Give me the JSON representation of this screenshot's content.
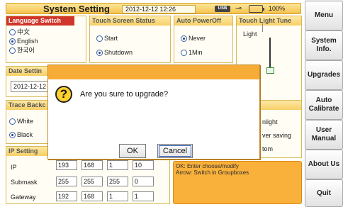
{
  "header": {
    "title": "System Setting",
    "datetime": "2012-12-12 12:26",
    "usb_label": "USB",
    "battery_label": "100%",
    "battery_level": 1.0
  },
  "language": {
    "title": "Language Switch",
    "options": [
      "中文",
      "English",
      "한국어"
    ],
    "selected": "English"
  },
  "touch_status": {
    "title": "Touch Screen Status",
    "options": [
      "Start",
      "Shutdown"
    ],
    "selected": "Shutdown"
  },
  "power_off": {
    "title": "Auto PowerOff",
    "options": [
      "Never",
      "1Min"
    ],
    "selected": "Never"
  },
  "touch_light": {
    "title": "Touch Light Tune",
    "light_label": "Light"
  },
  "date_setting": {
    "title": "Date Settin",
    "value": "2012-12-12"
  },
  "trace": {
    "title": "Trace Backc",
    "options": [
      "White",
      "Black"
    ],
    "selected": "Black"
  },
  "light_mode": {
    "title": "t",
    "options": [
      "nlight",
      "ver saving",
      "tom"
    ]
  },
  "ip_setting": {
    "title": "IP Setting",
    "rows": [
      {
        "label": "IP",
        "values": [
          "193",
          "168",
          "1",
          "10"
        ]
      },
      {
        "label": "Submask",
        "values": [
          "255",
          "255",
          "255",
          "0"
        ]
      },
      {
        "label": "Gateway",
        "values": [
          "192",
          "168",
          "1",
          "1"
        ]
      }
    ]
  },
  "info": {
    "line1": "OK: Enter choose/modify",
    "line2": "Arrow: Switch in Groupboxes"
  },
  "sidebar": [
    {
      "label": "Menu"
    },
    {
      "label": "System Info."
    },
    {
      "label": "Upgrades"
    },
    {
      "label": "Auto Calibrate"
    },
    {
      "label": "User Manual"
    },
    {
      "label": "About Us"
    },
    {
      "label": "Quit"
    }
  ],
  "dialog": {
    "message": "Are you sure to upgrade?",
    "ok_label": "OK",
    "cancel_label": "Cancel",
    "icon": "question-icon"
  },
  "colors": {
    "accent": "#f7ac38",
    "header": "#f4c24f",
    "language_title": "#d0352b"
  }
}
